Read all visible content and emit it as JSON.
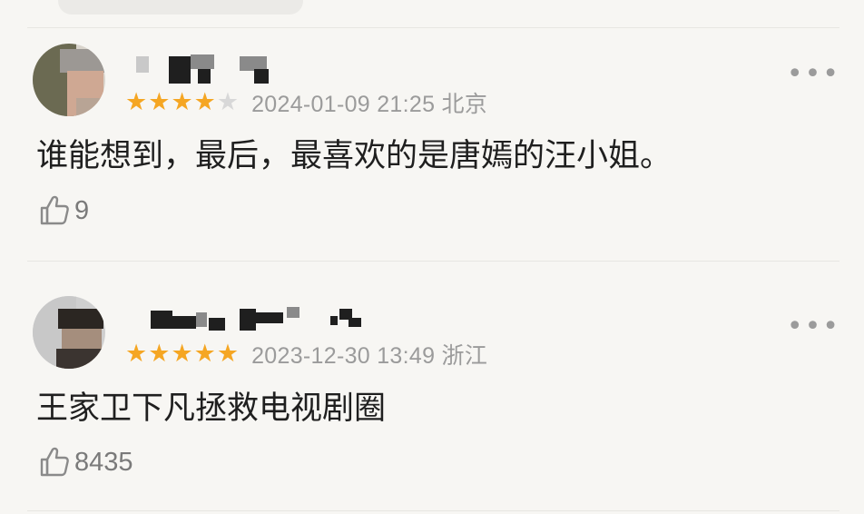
{
  "comments": [
    {
      "rating": 4,
      "date": "2024-01-09 21:25",
      "location": "北京",
      "meta": "2024-01-09 21:25 北京",
      "text": "谁能想到，最后，最喜欢的是唐嫣的汪小姐。",
      "likes": "9"
    },
    {
      "rating": 5,
      "date": "2023-12-30 13:49",
      "location": "浙江",
      "meta": "2023-12-30 13:49 浙江",
      "text": "王家卫下凡拯救电视剧圈",
      "likes": "8435"
    }
  ],
  "more_label": "•••",
  "star_color": "#f5a623",
  "icons": [
    "more-icon",
    "thumbs-up-icon",
    "star-icon"
  ]
}
